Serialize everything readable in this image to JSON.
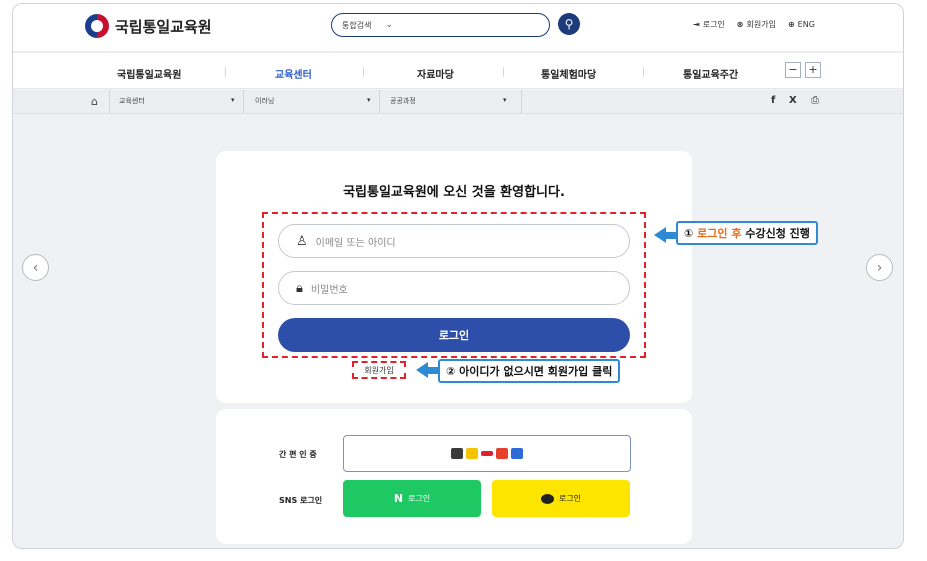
{
  "header": {
    "logo_text": "국립통일교육원",
    "search_scope": "통합검색",
    "util": [
      {
        "icon": "login-icon",
        "glyph": "⇥",
        "label": "로그인"
      },
      {
        "icon": "user-icon",
        "glyph": "⊗",
        "label": "회원가입"
      },
      {
        "icon": "globe-icon",
        "glyph": "⊕",
        "label": "ENG"
      }
    ]
  },
  "gnb": {
    "items": [
      "국립통일교육원",
      "교육센터",
      "자료마당",
      "통일체험마당",
      "통일교육주간"
    ],
    "active": "교육센터",
    "zoom_out": "−",
    "zoom_in": "+"
  },
  "breadcrumb": {
    "home_glyph": "⌂",
    "items": [
      "교육센터",
      "이러닝",
      "공공과정"
    ],
    "arrow": "▾",
    "share": {
      "facebook": "f",
      "x": "X",
      "print": "⎙"
    }
  },
  "login": {
    "welcome": "국립통일교육원에 오신 것을 환영합니다.",
    "id_placeholder": "이메일 또는 아이디",
    "pw_placeholder": "비밀번호",
    "button": "로그인",
    "join": "회원가입"
  },
  "annotations": {
    "first_num": "①",
    "first_highlight": "로그인 후",
    "first_rest": "수강신청 진행",
    "second": "② 아이디가 없으시면 회원가입 클릭"
  },
  "auth": {
    "easy_label": "간 편 인 증",
    "sns_label": "SNS 로그인",
    "naver_mark": "N",
    "naver_label": "로그인",
    "kakao_label": "로그인",
    "provider_colors": [
      "#3a3a3a",
      "#f5c400",
      "#e0202c",
      "#e6402e",
      "#2f6bd8"
    ]
  },
  "nav": {
    "prev": "‹",
    "next": "›"
  }
}
